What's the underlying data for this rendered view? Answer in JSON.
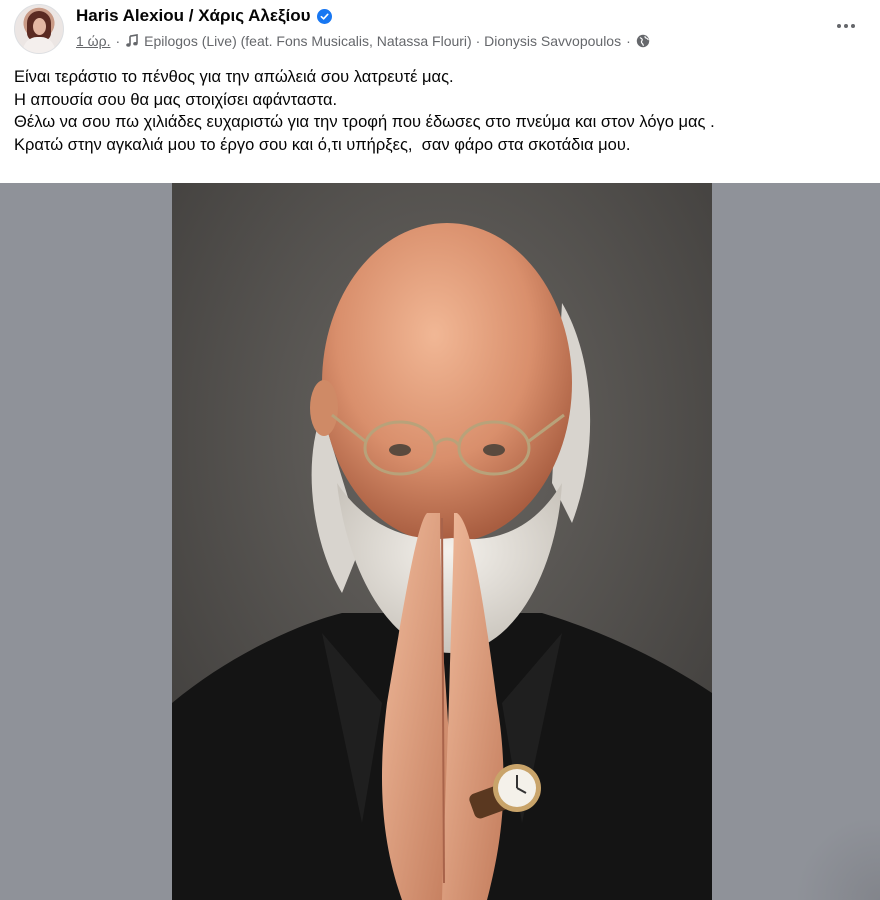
{
  "post": {
    "author": {
      "name": "Haris Alexiou / Χάρις Αλεξίου",
      "verified": true,
      "avatar_icon": "profile-avatar"
    },
    "meta": {
      "time": "1 ώρ.",
      "separator": "·",
      "music_icon": "music-note-icon",
      "song": "Epilogos (Live) (feat. Fons Musicalis, Natassa Flouri) · Dionysis Savvopoulos",
      "audience_icon": "globe-icon"
    },
    "more_icon": "more-options-icon",
    "text_lines": [
      "Είναι τεράστιο το πένθος για την απώλειά σου λατρευτέ μας.",
      "Η απουσία σου θα μας στοιχίσει αφάνταστα.",
      "Θέλω να σου πω χιλιάδες ευχαριστώ για την τροφή που έδωσες στο πνεύμα και στον λόγο μας .",
      "Κρατώ στην αγκαλιά μου το έργο σου και ό,τι υπήρξες,  σαν φάρο στα σκοτάδια μου."
    ],
    "photo": {
      "subject": "bald bearded man with round glasses, hands pressed together, wristwatch"
    }
  },
  "colors": {
    "verified_badge": "#1877f2",
    "meta_text": "#65676b",
    "photo_backdrop": "#8f9299"
  }
}
